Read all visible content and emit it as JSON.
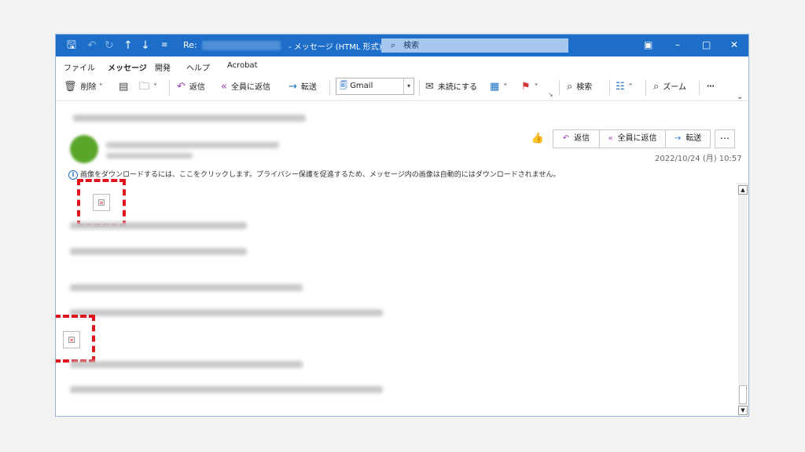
{
  "titlebar": {
    "re_prefix": "Re:",
    "title": "- メッセージ (HTML 形式)",
    "search_label": "検索",
    "icons": [
      "save-icon",
      "undo-icon",
      "redo-icon",
      "up-arrow-icon",
      "down-arrow-icon",
      "customize-icon"
    ]
  },
  "menubar": {
    "items": [
      "ファイル",
      "メッセージ",
      "開発",
      "ヘルプ",
      "Acrobat"
    ],
    "active": "メッセージ"
  },
  "ribbon": {
    "delete_label": "削除",
    "reply_label": "返信",
    "reply_all_label": "全員に返信",
    "forward_label": "転送",
    "quick_step": "Gmail",
    "unread_label": "未読にする",
    "search_label": "検索",
    "zoom_label": "ズーム"
  },
  "message": {
    "reply_label": "返信",
    "reply_all_label": "全員に返信",
    "forward_label": "転送",
    "datetime": "2022/10/24 (月) 10:57",
    "info_text": "画像をダウンロードするには、ここをクリックします。プライバシー保護を促進するため、メッセージ内の画像は自動的にはダウンロードされません。"
  },
  "colors": {
    "titlebar": "#1c6ec9",
    "highlight": "#e0141c"
  }
}
